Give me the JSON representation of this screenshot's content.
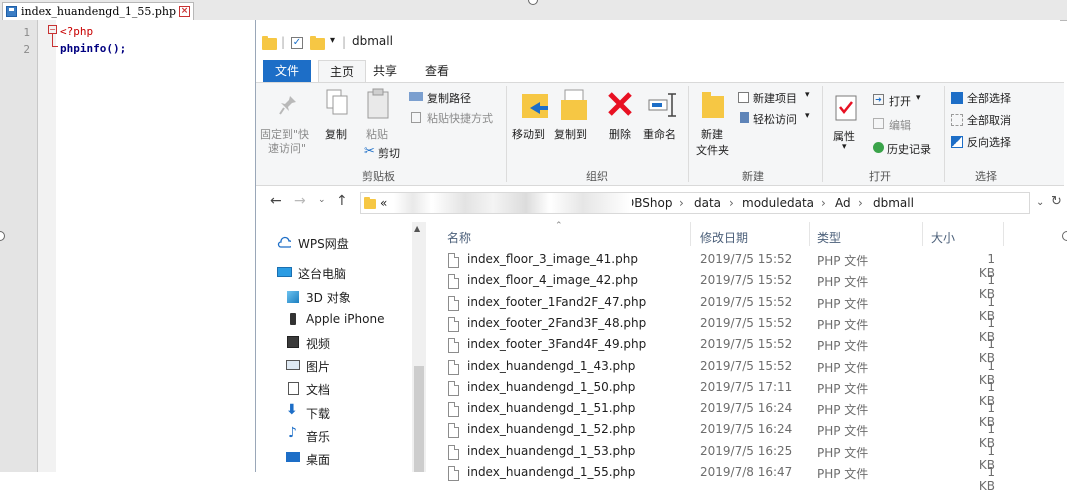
{
  "editor": {
    "tab_label": "index_huandengd_1_55.php",
    "line_numbers": [
      "1",
      "2"
    ],
    "lines": [
      "<?php",
      "phpinfo();"
    ]
  },
  "explorer": {
    "title": "dbmall",
    "ribbon_tabs": [
      "文件",
      "主页",
      "共享",
      "查看"
    ],
    "clipboard": {
      "pin_label_1": "固定到\"快",
      "pin_label_2": "速访问\"",
      "copy": "复制",
      "paste": "粘贴",
      "copy_path": "复制路径",
      "paste_shortcut": "粘贴快捷方式",
      "cut": "剪切",
      "group": "剪贴板"
    },
    "organize": {
      "move_to": "移动到",
      "copy_to": "复制到",
      "delete": "删除",
      "rename": "重命名",
      "group": "组织"
    },
    "new": {
      "new_folder_1": "新建",
      "new_folder_2": "文件夹",
      "new_item": "新建项目",
      "easy_access": "轻松访问",
      "group": "新建"
    },
    "open": {
      "properties": "属性",
      "open": "打开",
      "edit": "编辑",
      "history": "历史记录",
      "group": "打开"
    },
    "select": {
      "select_all": "全部选择",
      "select_none": "全部取消",
      "invert": "反向选择",
      "group": "选择"
    },
    "address": {
      "overflow": "«",
      "crumbs": [
        "DBShop",
        "data",
        "moduledata",
        "Ad",
        "dbmall"
      ]
    },
    "nav_pane": [
      "WPS网盘",
      "这台电脑",
      "3D 对象",
      "Apple iPhone",
      "视频",
      "图片",
      "文档",
      "下载",
      "音乐",
      "桌面"
    ],
    "columns": {
      "name": "名称",
      "date": "修改日期",
      "type": "类型",
      "size": "大小"
    },
    "files": [
      {
        "name": "index_floor_3_image_41.php",
        "date": "2019/7/5 15:52",
        "type": "PHP 文件",
        "size": "1 KB"
      },
      {
        "name": "index_floor_4_image_42.php",
        "date": "2019/7/5 15:52",
        "type": "PHP 文件",
        "size": "1 KB"
      },
      {
        "name": "index_footer_1Fand2F_47.php",
        "date": "2019/7/5 15:52",
        "type": "PHP 文件",
        "size": "1 KB"
      },
      {
        "name": "index_footer_2Fand3F_48.php",
        "date": "2019/7/5 15:52",
        "type": "PHP 文件",
        "size": "1 KB"
      },
      {
        "name": "index_footer_3Fand4F_49.php",
        "date": "2019/7/5 15:52",
        "type": "PHP 文件",
        "size": "1 KB"
      },
      {
        "name": "index_huandengd_1_43.php",
        "date": "2019/7/5 15:52",
        "type": "PHP 文件",
        "size": "1 KB"
      },
      {
        "name": "index_huandengd_1_50.php",
        "date": "2019/7/5 17:11",
        "type": "PHP 文件",
        "size": "1 KB"
      },
      {
        "name": "index_huandengd_1_51.php",
        "date": "2019/7/5 16:24",
        "type": "PHP 文件",
        "size": "1 KB"
      },
      {
        "name": "index_huandengd_1_52.php",
        "date": "2019/7/5 16:24",
        "type": "PHP 文件",
        "size": "1 KB"
      },
      {
        "name": "index_huandengd_1_53.php",
        "date": "2019/7/5 16:25",
        "type": "PHP 文件",
        "size": "1 KB"
      },
      {
        "name": "index_huandengd_1_55.php",
        "date": "2019/7/8 16:47",
        "type": "PHP 文件",
        "size": "1 KB"
      }
    ]
  }
}
